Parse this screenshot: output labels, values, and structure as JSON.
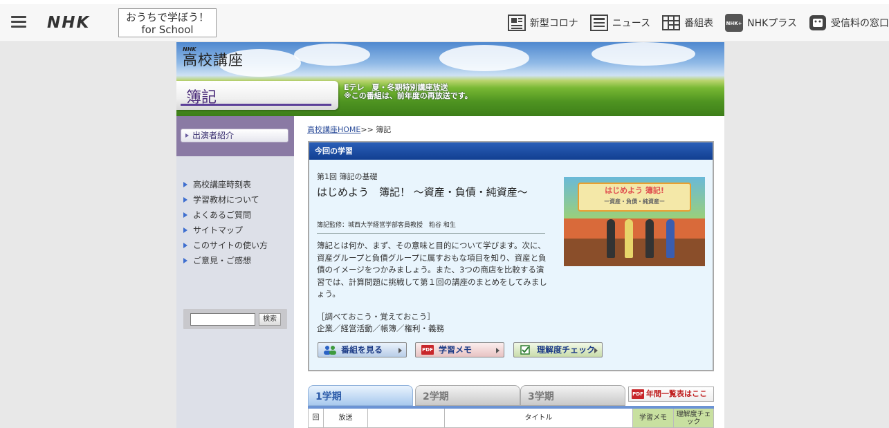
{
  "topbar": {
    "logo": "NHK",
    "school_line1": "おうちで学ぼう！",
    "school_line2": "for School",
    "nav": [
      {
        "label": "新型コロナ",
        "icon": "news-corona-icon"
      },
      {
        "label": "ニュース",
        "icon": "news-icon"
      },
      {
        "label": "番組表",
        "icon": "program-guide-icon"
      },
      {
        "label": "NHKプラス",
        "icon": "nhk-plus-icon"
      },
      {
        "label": "受信料の窓口",
        "icon": "fee-icon"
      }
    ]
  },
  "banner": {
    "nhk": "NHK",
    "series": "高校講座",
    "subject": "簿記",
    "note1": "Eテレ　夏・冬期特別講座放送",
    "note2": "※この番組は、前年度の再放送です。"
  },
  "sidebar": {
    "profile": "出演者紹介",
    "menu": [
      "高校講座時刻表",
      "学習教材について",
      "よくあるご質問",
      "サイトマップ",
      "このサイトの使い方",
      "ご意見・ご感想"
    ],
    "search_button": "検索"
  },
  "breadcrumb": {
    "home": "高校講座HOME",
    "sep": ">> ",
    "current": "簿記"
  },
  "lesson": {
    "header": "今回の学習",
    "episode": "第1回 簿記の基礎",
    "title": "はじめよう　簿記！ ～資産・負債・純資産～",
    "supervisor": "簿記監修：城西大学経営学部客員教授　粕谷 和生",
    "description": "簿記とは何か、まず、その意味と目的について学びます。次に、資産グループと負債グループに属すおもな項目を知り、資産と負債のイメージをつかみましょう。また、3つの商店を比較する演習では、計算問題に挑戦して第１回の講座のまとめをしてみましょう。",
    "study_title": "［調べておこう・覚えておこう］",
    "study_items": "企業／経営活動／帳簿／権利・義務",
    "thumb_title": "はじめよう 簿記!",
    "thumb_sub": "ー資産・負債・純資産ー",
    "buttons": {
      "watch": "番組を見る",
      "memo": "学習メモ",
      "check": "理解度チェック"
    }
  },
  "tabs": {
    "t1": "1学期",
    "t2": "2学期",
    "t3": "3学期",
    "yearly": "年間一覧表はここ"
  },
  "table": {
    "headers": [
      "回",
      "放送",
      "",
      "タイトル",
      "学習メモ",
      "理解度チェック"
    ]
  },
  "colors": {
    "header_blue": "#1a4ea3",
    "purple": "#5b3f98",
    "tab_active": "#a8c9ee"
  }
}
